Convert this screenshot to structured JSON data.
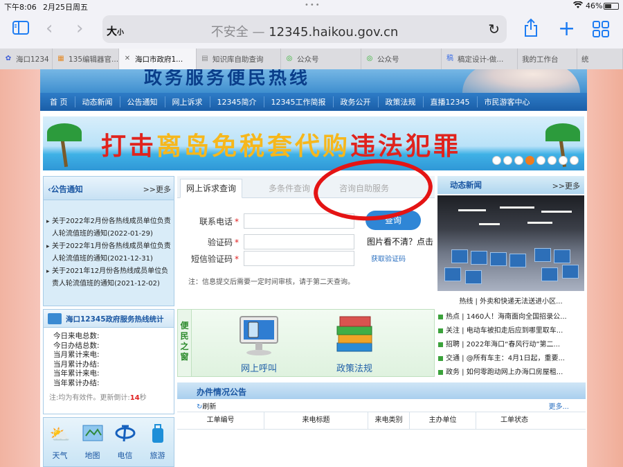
{
  "status": {
    "time": "下午8:06",
    "date": "2月25日周五",
    "battery": "46%"
  },
  "browser": {
    "text_size": "大",
    "text_size_small": "小",
    "url_insecure": "不安全 —",
    "url": "12345.haikou.gov.cn",
    "tabs": [
      {
        "label": "海口1234",
        "icon": "paw-icon",
        "color": "#3b5bd6"
      },
      {
        "label": "135编辑器官...",
        "icon": "editor-icon",
        "color": "#e38b2a"
      },
      {
        "label": "海口市政府1...",
        "icon": "close-icon",
        "color": "#666666"
      },
      {
        "label": "知识库自助查询",
        "icon": "doc-icon",
        "color": "#888888"
      },
      {
        "label": "公众号",
        "icon": "wechat-icon",
        "color": "#2fb12f"
      },
      {
        "label": "公众号",
        "icon": "wechat-icon",
        "color": "#2fb12f"
      },
      {
        "label": "稿定设计-做...",
        "icon": "design-icon",
        "color": "#3b6ee6"
      },
      {
        "label": "我的工作台",
        "icon": "none",
        "color": "#888888"
      },
      {
        "label": "统",
        "icon": "none",
        "color": "#888888"
      }
    ]
  },
  "site": {
    "header_slogan": "政务服务便民热线",
    "nav": [
      "首 页",
      "动态新闻",
      "公告通知",
      "网上诉求",
      "12345简介",
      "12345工作简报",
      "政务公开",
      "政策法规",
      "直播12345",
      "市民游客中心"
    ],
    "hero": {
      "part1": "打击",
      "part2": "离岛免税套代购",
      "part3": "违法犯罪",
      "dots_count": 8,
      "active_dot": 3
    },
    "notice": {
      "title": "公告通知",
      "more": ">>更多",
      "items": [
        "关于2022年2月份各热线成员单位负责人轮流值班的通知(2022-01-29)",
        "关于2022年1月份各热线成员单位负责人轮流值班的通知(2021-12-31)",
        "关于2021年12月份各热线成员单位负责人轮流值班的通知(2021-12-02)"
      ]
    },
    "stats": {
      "title": "海口12345政府服务热线统计",
      "rows": [
        "今日来电总数:",
        "今日办结总数:",
        "当月累计来电:",
        "当月累计办结:",
        "当年累计来电:",
        "当年累计办结:"
      ],
      "note_prefix": "注:均为有效件。更新倒计:",
      "countdown": "14",
      "note_suffix": "秒"
    },
    "services": [
      {
        "label": "天气",
        "icon": "weather-icon"
      },
      {
        "label": "地图",
        "icon": "map-icon"
      },
      {
        "label": "电信",
        "icon": "telecom-icon"
      },
      {
        "label": "旅游",
        "icon": "travel-icon"
      }
    ],
    "query": {
      "tabs": [
        "网上诉求查询",
        "多条件查询",
        "咨询自助服务"
      ],
      "fields": [
        {
          "label": "联系电话",
          "required": "*"
        },
        {
          "label": "验证码",
          "required": "*"
        },
        {
          "label": "短信验证码",
          "required": "*"
        }
      ],
      "button": "查询",
      "captcha_hint": "图片看不清？点击",
      "sms_link": "获取验证码",
      "note": "注：信息提交后需要一定时间审核，请于第二天查询。"
    },
    "convenience": {
      "side_label": "便民之窗",
      "items": [
        "网上呼叫",
        "政策法规"
      ]
    },
    "bulletin": {
      "title": "办件情况公告",
      "refresh": "刷新",
      "more": "更多...",
      "columns": [
        "工单编号",
        "来电标题",
        "来电类别",
        "主办单位",
        "工单状态"
      ]
    },
    "news": {
      "title": "动态新闻",
      "more": ">>更多",
      "caption": "热线 | 外卖和快递无法送进小区...",
      "items": [
        "热点 | 1460人！海南面向全国招录公...",
        "关注 | 电动车被扣走后应到哪里取车...",
        "招聘 | 2022年海口“春风行动”第二...",
        "交通 | @所有车主：4月1日起，重要...",
        "政务 | 如何零跑动网上办海口房屋租..."
      ]
    }
  }
}
